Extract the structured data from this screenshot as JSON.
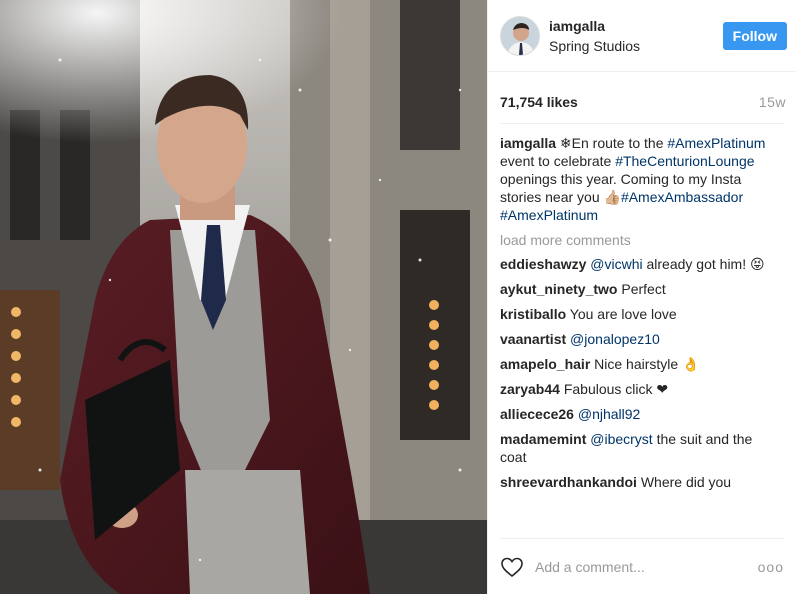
{
  "post": {
    "username": "iamgalla",
    "location": "Spring Studios",
    "follow_label": "Follow",
    "likes": "71,754 likes",
    "time": "15w",
    "caption": {
      "username": "iamgalla",
      "part1": " ❄En route to the ",
      "tag1": "#AmexPlatinum",
      "part2": " event to celebrate ",
      "tag2": "#TheCenturionLounge",
      "part3": " openings this year. Coming to my Insta stories near you 👍🏼",
      "tag3": "#AmexAmbassador",
      "part4": " ",
      "tag4": "#AmexPlatinum"
    },
    "load_more": "load more comments",
    "add_comment_placeholder": "Add a comment...",
    "more_label": "ooo"
  },
  "comments": [
    {
      "user": "eddieshawzy",
      "mention": "@vicwhi",
      "text": " already got him! 😝"
    },
    {
      "user": "aykut_ninety_two",
      "mention": "",
      "text": " Perfect"
    },
    {
      "user": "kristiballo",
      "mention": "",
      "text": " You are love love"
    },
    {
      "user": "vaanartist",
      "mention": "@jonalopez10",
      "text": ""
    },
    {
      "user": "amapelo_hair",
      "mention": "",
      "text": " Nice hairstyle 👌"
    },
    {
      "user": "zaryab44",
      "mention": "",
      "text": " Fabulous click ❤"
    },
    {
      "user": "alliecece26",
      "mention": "@njhall92",
      "text": ""
    },
    {
      "user": "madamemint",
      "mention": "@ibecryst",
      "text": " the suit and the coat"
    },
    {
      "user": "shreevardhankandoi",
      "mention": "",
      "text": " Where did you"
    }
  ],
  "icons": {
    "heart": "heart-icon",
    "more": "more-options-icon"
  },
  "colors": {
    "follow": "#3897f0",
    "hashtag": "#003569",
    "muted": "#999999"
  }
}
